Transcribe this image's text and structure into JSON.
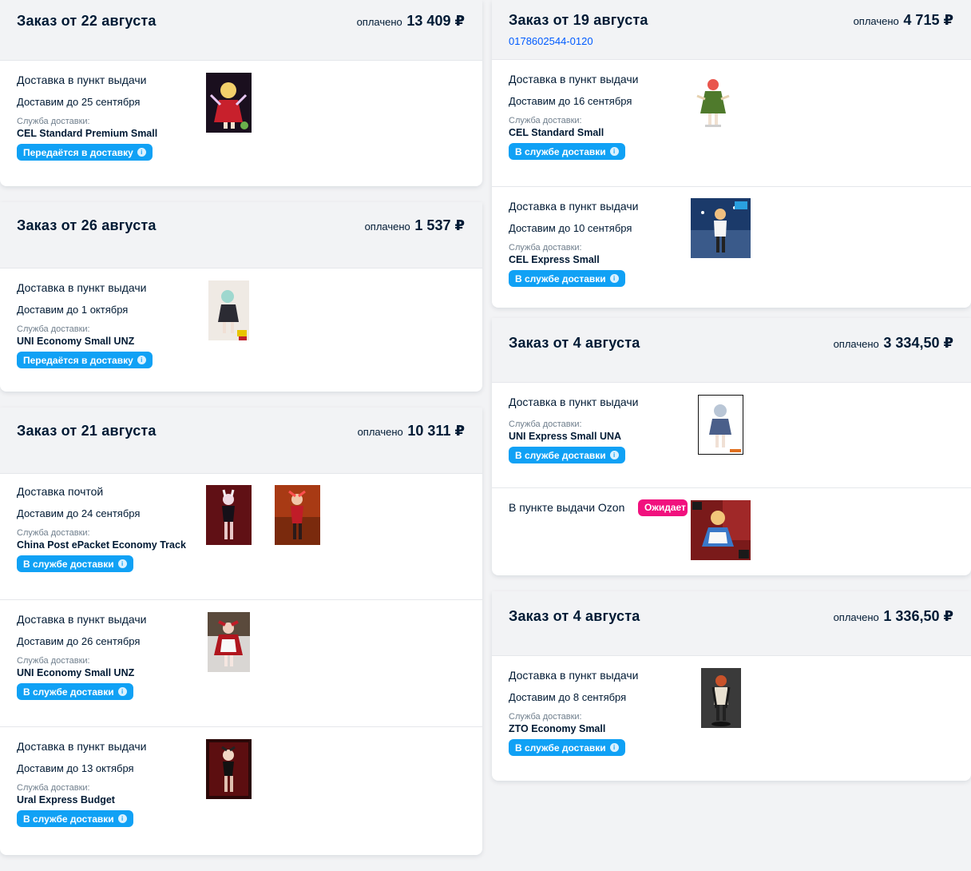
{
  "common": {
    "paid_label": "оплачено",
    "service_label": "Служба доставки:"
  },
  "orders": [
    {
      "title": "Заказ от 22 августа",
      "amount": "13 409 ₽",
      "shipments": [
        {
          "type": "Доставка в пункт выдачи",
          "date": "Доставим до 25 сентября",
          "service": "CEL Standard Premium Small",
          "status": "Передаётся в доставку"
        }
      ]
    },
    {
      "title": "Заказ от 26 августа",
      "amount": "1 537 ₽",
      "shipments": [
        {
          "type": "Доставка в пункт выдачи",
          "date": "Доставим до 1 октября",
          "service": "UNI Economy Small UNZ",
          "status": "Передаётся в доставку"
        }
      ]
    },
    {
      "title": "Заказ от 21 августа",
      "amount": "10 311 ₽",
      "shipments": [
        {
          "type": "Доставка почтой",
          "date": "Доставим до 24 сентября",
          "service": "China Post ePacket Economy Track",
          "status": "В службе доставки"
        },
        {
          "type": "Доставка в пункт выдачи",
          "date": "Доставим до 26 сентября",
          "service": "UNI Economy Small UNZ",
          "status": "В службе доставки"
        },
        {
          "type": "Доставка в пункт выдачи",
          "date": "Доставим до 13 октября",
          "service": "Ural Express Budget",
          "status": "В службе доставки"
        }
      ]
    },
    {
      "title": "Заказ от 19 августа",
      "number": "0178602544-0120",
      "amount": "4 715 ₽",
      "shipments": [
        {
          "type": "Доставка в пункт выдачи",
          "date": "Доставим до 16 сентября",
          "service": "CEL Standard Small",
          "status": "В службе доставки"
        },
        {
          "type": "Доставка в пункт выдачи",
          "date": "Доставим до 10 сентября",
          "service": "CEL Express Small",
          "status": "В службе доставки"
        }
      ]
    },
    {
      "title": "Заказ от 4 августа",
      "amount": "3 334,50 ₽",
      "shipments": [
        {
          "type": "Доставка в пункт выдачи",
          "service": "UNI Express Small UNA",
          "status": "В службе доставки"
        },
        {
          "type": "В пункте выдачи Ozon",
          "status": "Ожидает"
        }
      ]
    },
    {
      "title": "Заказ от 4 августа",
      "amount": "1 336,50 ₽",
      "shipments": [
        {
          "type": "Доставка в пункт выдачи",
          "date": "Доставим до 8 сентября",
          "service": "ZTO Economy Small",
          "status": "В службе доставки"
        }
      ]
    }
  ],
  "colors": {
    "badge_blue": "#10a1f5",
    "badge_pink": "#f1117e",
    "link": "#005bff",
    "text": "#001a34",
    "muted": "#707f8d"
  }
}
